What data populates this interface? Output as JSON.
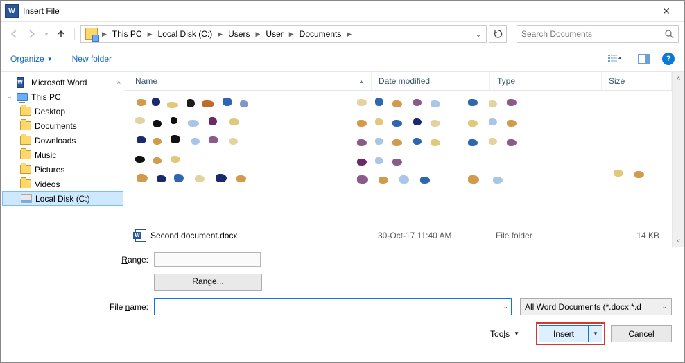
{
  "title": "Insert File",
  "breadcrumb": [
    "This PC",
    "Local Disk (C:)",
    "Users",
    "User",
    "Documents"
  ],
  "search_placeholder": "Search Documents",
  "toolbar": {
    "organize": "Organize",
    "new_folder": "New folder"
  },
  "tree": [
    {
      "label": "Microsoft Word",
      "icon": "word",
      "indent": 0,
      "expand": ""
    },
    {
      "label": "This PC",
      "icon": "pc",
      "indent": 0,
      "expand": "▾"
    },
    {
      "label": "Desktop",
      "icon": "folder",
      "indent": 1,
      "expand": ""
    },
    {
      "label": "Documents",
      "icon": "folder",
      "indent": 1,
      "expand": ""
    },
    {
      "label": "Downloads",
      "icon": "folder",
      "indent": 1,
      "expand": ""
    },
    {
      "label": "Music",
      "icon": "folder",
      "indent": 1,
      "expand": ""
    },
    {
      "label": "Pictures",
      "icon": "folder",
      "indent": 1,
      "expand": ""
    },
    {
      "label": "Videos",
      "icon": "folder",
      "indent": 1,
      "expand": ""
    },
    {
      "label": "Local Disk (C:)",
      "icon": "disk",
      "indent": 1,
      "expand": "",
      "selected": true
    }
  ],
  "columns": {
    "name": "Name",
    "date": "Date modified",
    "type": "Type",
    "size": "Size"
  },
  "file": {
    "name": "Second document.docx",
    "date": "30-Oct-17 11:40 AM",
    "type": "File folder",
    "size": "14 KB"
  },
  "range_label": "Range:",
  "range_button": "Range...",
  "filename_label": "File name:",
  "filename_value": "",
  "filter": "All Word Documents (*.docx;*.d",
  "tools": "Tools",
  "insert": "Insert",
  "cancel": "Cancel"
}
